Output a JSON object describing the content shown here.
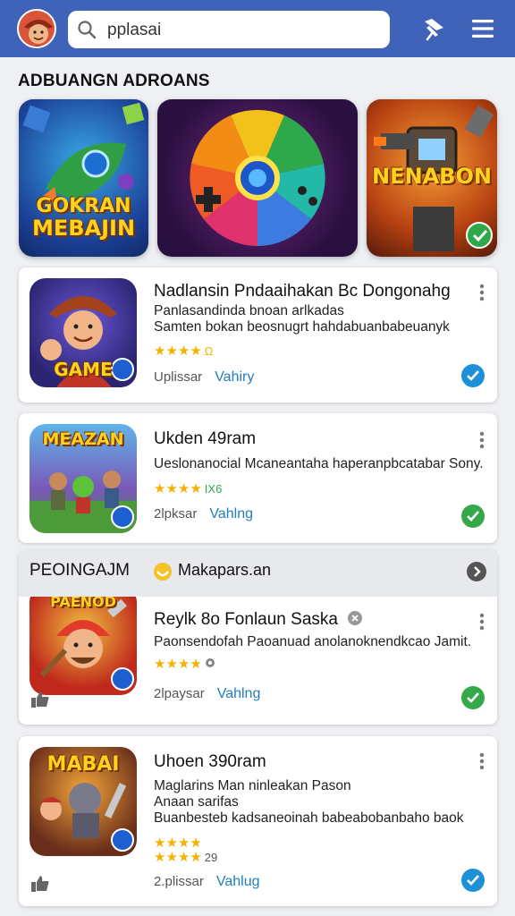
{
  "header": {
    "search_text": "pplasai"
  },
  "section": {
    "title": "ADBUANGN ADROANS"
  },
  "banners": [
    {
      "text_line1": "GOKRAN",
      "text_line2": "MEBAJIN"
    },
    {
      "text_line1": "",
      "text_line2": ""
    },
    {
      "text_line1": "NENABON",
      "text_line2": ""
    }
  ],
  "apps": [
    {
      "title": "Nadlansin Pndaaihakan Bc Dongonahg",
      "desc1": "Panlasandinda bnoan arlkadas",
      "desc2": "Samten  bokan beosnugrt hahdabuanbabeuanyk",
      "stars": "★★★★",
      "rating_tag": "Ω",
      "size": "Uplissar",
      "link": "Vahiry",
      "icon_text": "GAME"
    },
    {
      "title": "Ukden 49ram",
      "desc1": "Ueslonanocial  Mcaneantaha haperanpbcatabar Sony..",
      "stars": "★★★★",
      "rating_tag": "IX6",
      "size": "2lpksar",
      "link": "Vahlng",
      "icon_text": "MEAZAN"
    },
    {
      "title": "Reylk 8o Fonlaun Saska",
      "desc1": "Paonsendofah Paoanuad anolanoknendkcao Jamit.",
      "stars": "★★★★",
      "rating_tag": "",
      "size": "2lpaysar",
      "link": "Vahlng",
      "icon_text": "PAENOD"
    },
    {
      "title": "Uhoen 390ram",
      "desc1": "Maglarins Man ninleakan Pason",
      "desc2": "Anaan sarifas",
      "desc3": "Buanbesteb kadsaneoinah babeabobanbaho baok",
      "stars": "★★★★",
      "stars2": "★★★★",
      "rating_tag": "29",
      "size": "2.plissar",
      "link": "Vahlug",
      "icon_text": "MABAI"
    }
  ],
  "group": {
    "title": "PEOINGAJM",
    "subtitle": "Makapars.an"
  },
  "colors": {
    "topbar": "#3f63b8",
    "link": "#1f7fbf",
    "star": "#f2b300",
    "badge_blue": "#1e90d8",
    "badge_green": "#35a84a"
  }
}
